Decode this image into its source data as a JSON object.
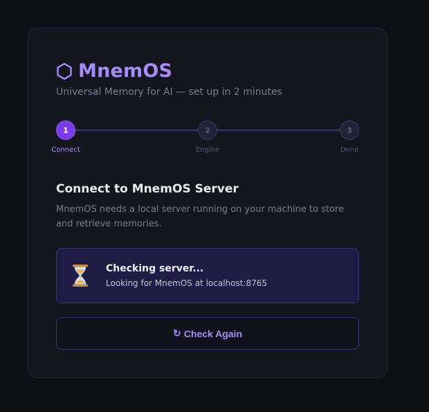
{
  "brand": {
    "name": "MnemOS",
    "icon": "hexagon-icon"
  },
  "tagline": "Universal Memory for AI — set up in 2 minutes",
  "stepper": {
    "current": 1,
    "steps": [
      {
        "number": "1",
        "label": "Connect",
        "state": "active"
      },
      {
        "number": "2",
        "label": "Engine",
        "state": "pending"
      },
      {
        "number": "3",
        "label": "Done",
        "state": "pending"
      }
    ]
  },
  "section": {
    "title": "Connect to MnemOS Server",
    "description": "MnemOS needs a local server running on your machine to store and retrieve memories."
  },
  "status": {
    "icon": "hourglass-icon",
    "title": "Checking server...",
    "subtitle": "Looking for MnemOS at localhost:8765"
  },
  "action": {
    "icon": "↻",
    "label": "Check Again"
  },
  "colors": {
    "accent": "#a78bfa",
    "accent_strong": "#7c3aed",
    "background": "#0f0f17",
    "card": "#15151f",
    "status_bg": "#1f1b45"
  }
}
